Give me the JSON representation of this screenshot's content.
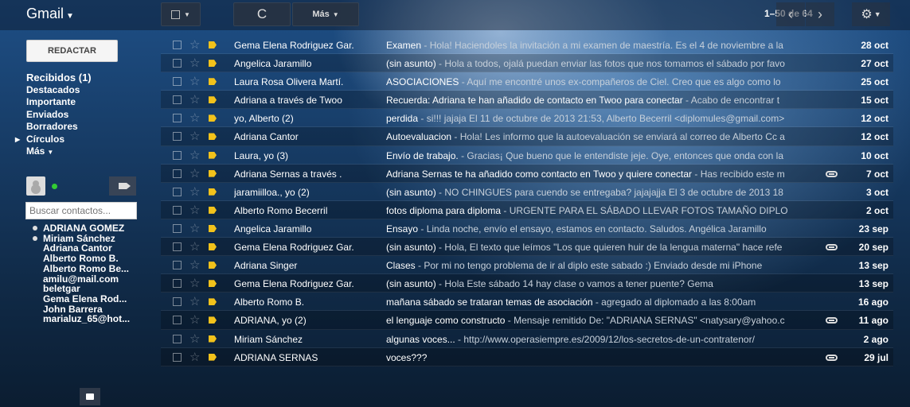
{
  "app": {
    "title": "Gmail"
  },
  "toolbar": {
    "refresh_label": "C",
    "more_label": "Más",
    "paging": "1–50 de 64"
  },
  "sidebar": {
    "compose_label": "REDACTAR",
    "items": [
      {
        "label": "Recibidos (1)"
      },
      {
        "label": "Destacados"
      },
      {
        "label": "Importante"
      },
      {
        "label": "Enviados"
      },
      {
        "label": "Borradores"
      },
      {
        "label": "Círculos"
      },
      {
        "label": "Más"
      }
    ],
    "search_placeholder": "Buscar contactos...",
    "contacts": [
      {
        "name": "ADRIANA GOMEZ",
        "status": "online"
      },
      {
        "name": "Miriam Sánchez",
        "status": "online"
      },
      {
        "name": "Adriana Cantor",
        "status": "none"
      },
      {
        "name": "Alberto Romo B.",
        "status": "none"
      },
      {
        "name": "Alberto Romo Be...",
        "status": "none"
      },
      {
        "name": "amilu@mail.com",
        "status": "none"
      },
      {
        "name": "beletgar",
        "status": "none"
      },
      {
        "name": "Gema Elena Rod...",
        "status": "none"
      },
      {
        "name": "John Barrera",
        "status": "none"
      },
      {
        "name": "marialuz_65@hot...",
        "status": "none"
      }
    ]
  },
  "emails": [
    {
      "sender": "Gema Elena Rodriguez Gar.",
      "subject": "Examen",
      "snippet": " - Hola! Haciendoles la invitación a mi examen de maestría. Es el 4 de noviembre a la",
      "date": "28 oct",
      "thread": false
    },
    {
      "sender": "Angelica Jaramillo",
      "subject": "(sin asunto)",
      "snippet": " - Hola a todos, ojalá puedan enviar las fotos que nos tomamos el sábado por favo",
      "date": "27 oct",
      "thread": false
    },
    {
      "sender": "Laura Rosa Olivera Martí.",
      "subject": "ASOCIACIONES",
      "snippet": " - Aquí me encontré unos ex-compañeros de Ciel. Creo que es algo como lo",
      "date": "25 oct",
      "thread": false
    },
    {
      "sender": "Adriana a través de Twoo",
      "subject": "Recuerda: Adriana te han añadido de contacto en Twoo para conectar",
      "snippet": " - Acabo de encontrar t",
      "date": "15 oct",
      "thread": false
    },
    {
      "sender": "yo, Alberto (2)",
      "subject": "perdida",
      "snippet": " - si!!! jajaja El 11 de octubre de 2013 21:53, Alberto Becerril <diplomules@gmail.com>",
      "date": "12 oct",
      "thread": false
    },
    {
      "sender": "Adriana Cantor",
      "subject": "Autoevaluacion",
      "snippet": " - Hola! Les informo que la autoevaluación se enviará al correo de Alberto Cc a",
      "date": "12 oct",
      "thread": false
    },
    {
      "sender": "Laura, yo (3)",
      "subject": "Envío de trabajo.",
      "snippet": " - Gracias¡ Que bueno que le entendiste jeje. Oye, entonces que onda con la",
      "date": "10 oct",
      "thread": false
    },
    {
      "sender": "Adriana Sernas a través .",
      "subject": "Adriana Sernas te ha añadido como contacto en Twoo y quiere conectar",
      "snippet": " - Has recibido este m",
      "date": "7 oct",
      "thread": true
    },
    {
      "sender": "jaramiilloa., yo (2)",
      "subject": "(sin asunto)",
      "snippet": " - NO CHINGUES para cuendo se entregaba? jajajajja El 3 de octubre de 2013 18",
      "date": "3 oct",
      "thread": false
    },
    {
      "sender": "Alberto Romo Becerril",
      "subject": "fotos diploma para diploma",
      "snippet": " - URGENTE PARA EL SÁBADO LLEVAR FOTOS TAMAÑO DIPLO",
      "date": "2 oct",
      "thread": false
    },
    {
      "sender": "Angelica Jaramillo",
      "subject": "Ensayo",
      "snippet": " - Linda noche, envío el ensayo, estamos en contacto. Saludos. Angélica Jaramillo",
      "date": "23 sep",
      "thread": false
    },
    {
      "sender": "Gema Elena Rodriguez Gar.",
      "subject": "(sin asunto)",
      "snippet": " - Hola, El texto que leímos \"Los que quieren huir de la lengua materna\" hace refe",
      "date": "20 sep",
      "thread": true
    },
    {
      "sender": "Adriana Singer",
      "subject": "Clases",
      "snippet": " - Por mi no tengo problema de ir al diplo este sabado :) Enviado desde mi iPhone",
      "date": "13 sep",
      "thread": false
    },
    {
      "sender": "Gema Elena Rodriguez Gar.",
      "subject": "(sin asunto)",
      "snippet": " - Hola Este sábado 14 hay clase o vamos a tener puente? Gema",
      "date": "13 sep",
      "thread": false
    },
    {
      "sender": "Alberto Romo B.",
      "subject": "mañana sábado se trataran temas de asociación",
      "snippet": " - agregado al diplomado a las 8:00am",
      "date": "16 ago",
      "thread": false
    },
    {
      "sender": "ADRIANA, yo (2)",
      "subject": "el lenguaje como constructo",
      "snippet": " - Mensaje remitido De: \"ADRIANA SERNAS\" <natysary@yahoo.c",
      "date": "11 ago",
      "thread": true
    },
    {
      "sender": "Miriam Sánchez",
      "subject": "algunas voces...",
      "snippet": " - http://www.operasiempre.es/2009/12/los-secretos-de-un-contratenor/",
      "date": "2 ago",
      "thread": false
    },
    {
      "sender": "ADRIANA SERNAS",
      "subject": "voces???",
      "snippet": "",
      "date": "29 jul",
      "thread": true
    }
  ]
}
